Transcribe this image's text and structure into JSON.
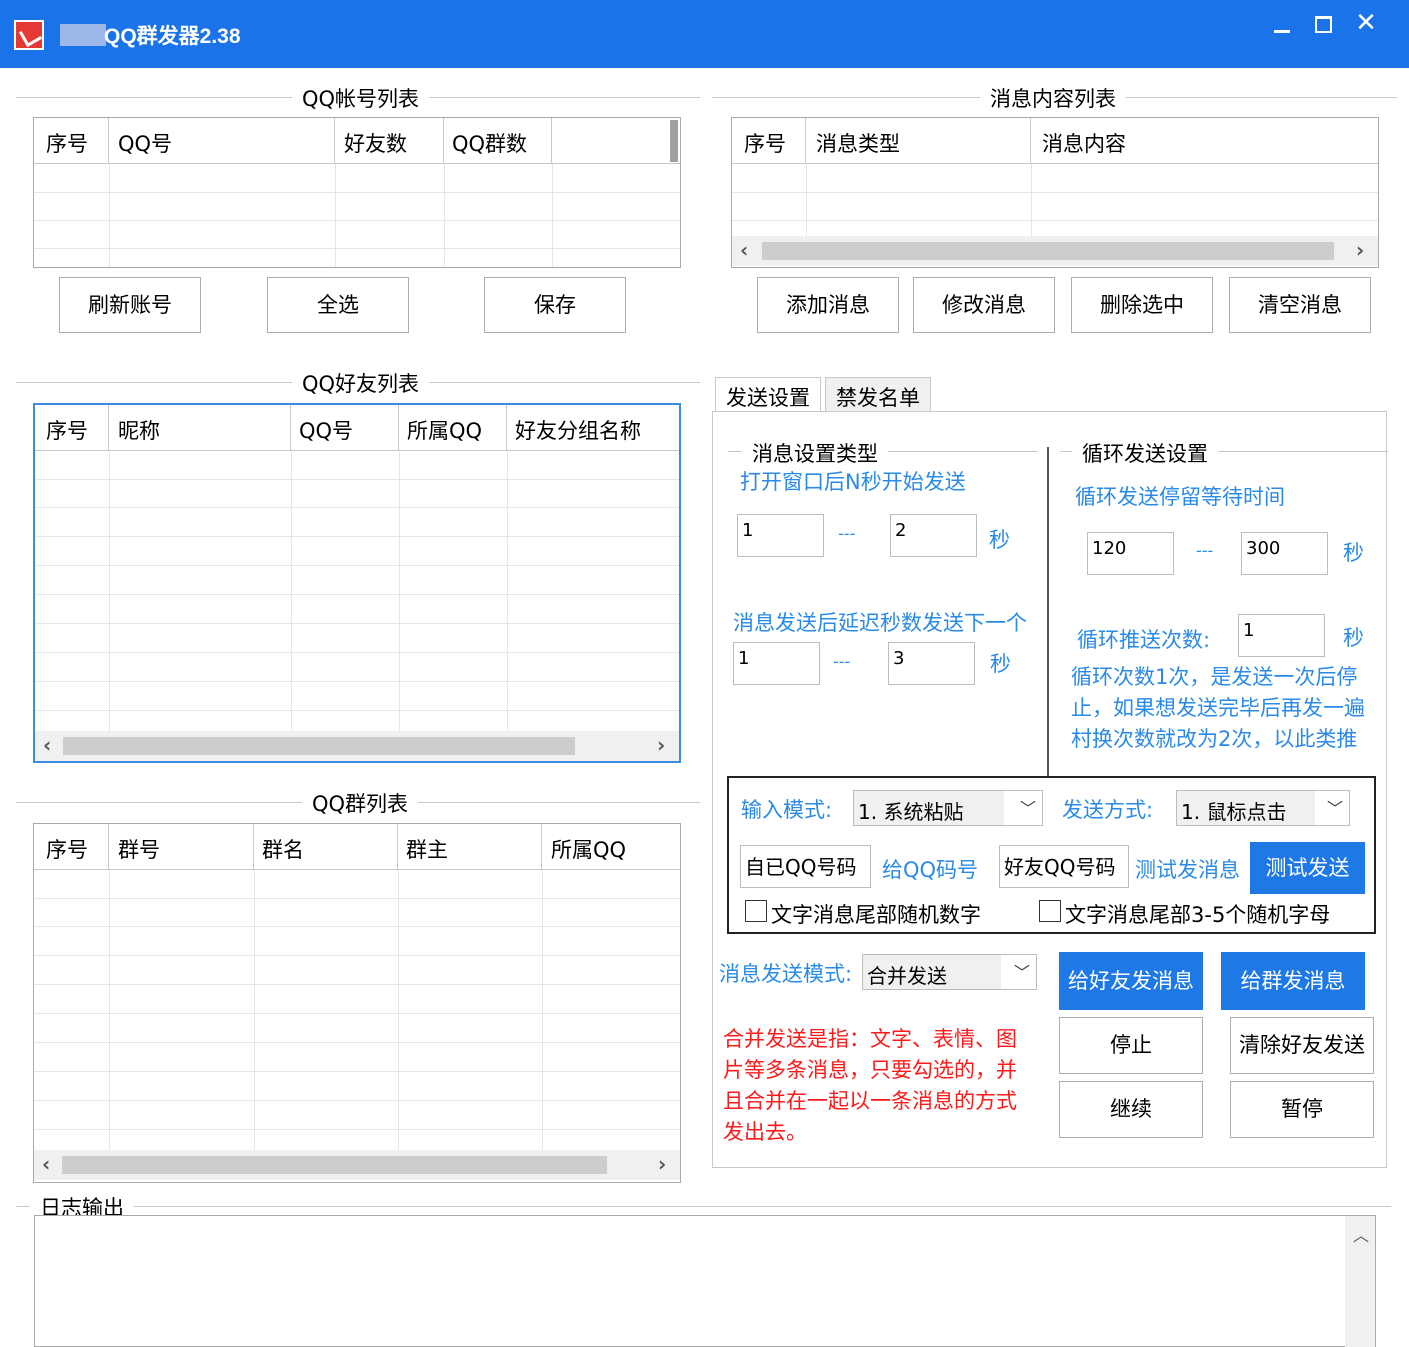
{
  "window": {
    "title": "QQ群发器2.38",
    "controls": [
      "minimize",
      "maximize",
      "close"
    ]
  },
  "account_list": {
    "title": "QQ帐号列表",
    "columns": [
      "序号",
      "QQ号",
      "好友数",
      "QQ群数"
    ],
    "rows": [],
    "buttons": {
      "refresh": "刷新账号",
      "select_all": "全选",
      "save": "保存"
    }
  },
  "message_list": {
    "title": "消息内容列表",
    "columns": [
      "序号",
      "消息类型",
      "消息内容"
    ],
    "rows": [],
    "buttons": {
      "add": "添加消息",
      "edit": "修改消息",
      "delete": "删除选中",
      "clear": "清空消息"
    }
  },
  "friend_list": {
    "title": "QQ好友列表",
    "columns": [
      "序号",
      "昵称",
      "QQ号",
      "所属QQ",
      "好友分组名称"
    ],
    "rows": []
  },
  "group_list": {
    "title": "QQ群列表",
    "columns": [
      "序号",
      "群号",
      "群名",
      "群主",
      "所属QQ"
    ],
    "rows": []
  },
  "tabs": [
    "发送设置",
    "禁发名单"
  ],
  "send_settings": {
    "msg_type_title": "消息设置类型",
    "open_delay_label": "打开窗口后N秒开始发送",
    "open_delay_min": "1",
    "open_delay_max": "2",
    "sep": "---",
    "unit_sec": "秒",
    "after_send_label": "消息发送后延迟秒数发送下一个",
    "after_send_min": "1",
    "after_send_max": "3",
    "loop_title": "循环发送设置",
    "loop_wait_label": "循环发送停留等待时间",
    "loop_wait_min": "120",
    "loop_wait_max": "300",
    "loop_count_label": "循环推送次数:",
    "loop_count": "1",
    "loop_note": "循环次数1次，是发送一次后停止，如果想发送完毕后再发一遍村换次数就改为2次，以此类推",
    "input_mode_label": "输入模式:",
    "input_mode_value": "1. 系统粘贴",
    "send_method_label": "发送方式:",
    "send_method_value": "1. 鼠标点击",
    "self_qq_placeholder": "自已QQ号码",
    "to_qq_label": "给QQ码号",
    "friend_qq_placeholder": "好友QQ号码",
    "test_msg_label": "测试发消息",
    "test_send_button": "测试发送",
    "random_digits_label": "文字消息尾部随机数字",
    "random_letters_label": "文字消息尾部3-5个随机字母",
    "send_mode_label": "消息发送模式:",
    "send_mode_value": "合并发送",
    "merge_note": "合并发送是指：文字、表情、图片等多条消息，只要勾选的，并且合并在一起以一条消息的方式发出去。",
    "btn_friend_send": "给好友发消息",
    "btn_group_send": "给群发消息",
    "btn_stop": "停止",
    "btn_clear_friend": "清除好友发送",
    "btn_continue": "继续",
    "btn_pause": "暂停"
  },
  "log": {
    "title": "日志输出"
  }
}
